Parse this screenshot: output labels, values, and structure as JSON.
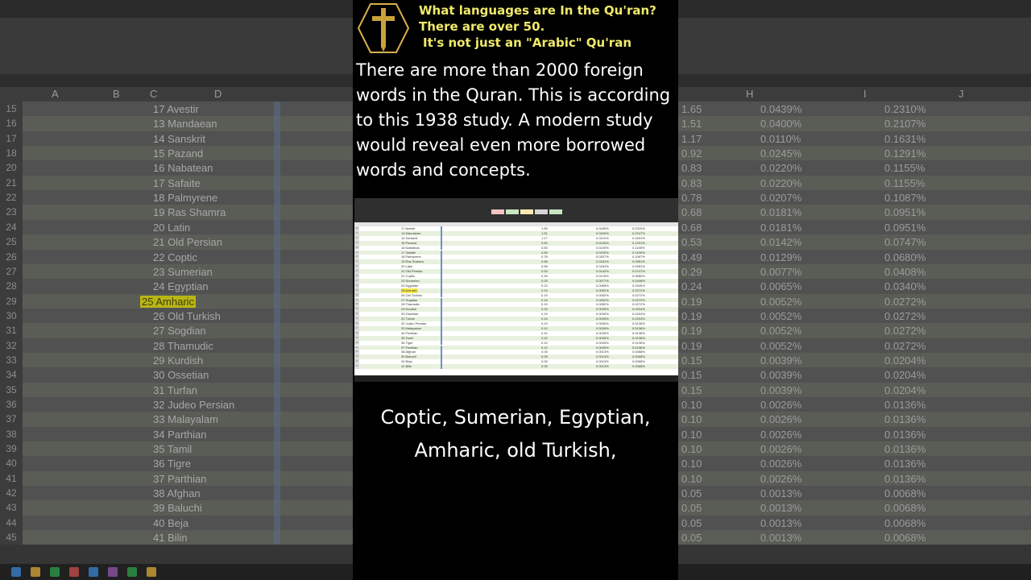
{
  "header": {
    "line1": "What languages are In the Qu'ran?",
    "line2": "There are over 50.",
    "line3": "It's not just an \"Arabic\" Qu'ran"
  },
  "body_text": "There are more than 2000 foreign words in the Quran. This is according to this 1938 study. A modern study would reveal even more borrowed words and concepts.",
  "caption": {
    "line1": "Coptic, Sumerian, Egyptian,",
    "line2": "Amharic, old Turkish,"
  },
  "icons": {
    "logo": "golden-cross-icon"
  },
  "colors": {
    "header_text": "#f1ea6a",
    "highlight": "#b9b514",
    "panel_bg": "#000000"
  },
  "background_sheet": {
    "columns": [
      "A",
      "B",
      "C",
      "D",
      "H",
      "I",
      "J"
    ],
    "rows": [
      {
        "n": "15",
        "lang": "17 Avestir",
        "v1": "1.65",
        "v2": "0.0439%",
        "v3": "0.2310%"
      },
      {
        "n": "16",
        "lang": "13 Mandaean",
        "v1": "1.51",
        "v2": "0.0400%",
        "v3": "0.2107%"
      },
      {
        "n": "17",
        "lang": "14 Sanskrit",
        "v1": "1.17",
        "v2": "0.0110%",
        "v3": "0.1631%"
      },
      {
        "n": "18",
        "lang": "15 Pazand",
        "v1": "0.92",
        "v2": "0.0245%",
        "v3": "0.1291%"
      },
      {
        "n": "20",
        "lang": "16 Nabatean",
        "v1": "0.83",
        "v2": "0.0220%",
        "v3": "0.1155%"
      },
      {
        "n": "21",
        "lang": "17 Safaite",
        "v1": "0.83",
        "v2": "0.0220%",
        "v3": "0.1155%"
      },
      {
        "n": "22",
        "lang": "18 Palmyrene",
        "v1": "0.78",
        "v2": "0.0207%",
        "v3": "0.1087%"
      },
      {
        "n": "23",
        "lang": "19 Ras Shamra",
        "v1": "0.68",
        "v2": "0.0181%",
        "v3": "0.0951%"
      },
      {
        "n": "24",
        "lang": "20 Latin",
        "v1": "0.68",
        "v2": "0.0181%",
        "v3": "0.0951%"
      },
      {
        "n": "25",
        "lang": "21 Old Persian",
        "v1": "0.53",
        "v2": "0.0142%",
        "v3": "0.0747%"
      },
      {
        "n": "26",
        "lang": "22 Coptic",
        "v1": "0.49",
        "v2": "0.0129%",
        "v3": "0.0680%"
      },
      {
        "n": "27",
        "lang": "23 Sumerian",
        "v1": "0.29",
        "v2": "0.0077%",
        "v3": "0.0408%"
      },
      {
        "n": "28",
        "lang": "24 Egyptian",
        "v1": "0.24",
        "v2": "0.0065%",
        "v3": "0.0340%"
      },
      {
        "n": "29",
        "lang": "25 Amharic",
        "v1": "0.19",
        "v2": "0.0052%",
        "v3": "0.0272%"
      },
      {
        "n": "30",
        "lang": "26 Old Turkish",
        "v1": "0.19",
        "v2": "0.0052%",
        "v3": "0.0272%"
      },
      {
        "n": "31",
        "lang": "27 Sogdian",
        "v1": "0.19",
        "v2": "0.0052%",
        "v3": "0.0272%"
      },
      {
        "n": "32",
        "lang": "28 Thamudic",
        "v1": "0.19",
        "v2": "0.0052%",
        "v3": "0.0272%"
      },
      {
        "n": "33",
        "lang": "29 Kurdish",
        "v1": "0.15",
        "v2": "0.0039%",
        "v3": "0.0204%"
      },
      {
        "n": "34",
        "lang": "30 Ossetian",
        "v1": "0.15",
        "v2": "0.0039%",
        "v3": "0.0204%"
      },
      {
        "n": "35",
        "lang": "31 Turfan",
        "v1": "0.15",
        "v2": "0.0039%",
        "v3": "0.0204%"
      },
      {
        "n": "36",
        "lang": "32 Judeo Persian",
        "v1": "0.10",
        "v2": "0.0026%",
        "v3": "0.0136%"
      },
      {
        "n": "37",
        "lang": "33 Malayalam",
        "v1": "0.10",
        "v2": "0.0026%",
        "v3": "0.0136%"
      },
      {
        "n": "38",
        "lang": "34 Parthian",
        "v1": "0.10",
        "v2": "0.0026%",
        "v3": "0.0136%"
      },
      {
        "n": "39",
        "lang": "35 Tamil",
        "v1": "0.10",
        "v2": "0.0026%",
        "v3": "0.0136%"
      },
      {
        "n": "40",
        "lang": "36 Tigre",
        "v1": "0.10",
        "v2": "0.0026%",
        "v3": "0.0136%"
      },
      {
        "n": "41",
        "lang": "37 Parthian",
        "v1": "0.10",
        "v2": "0.0026%",
        "v3": "0.0136%"
      },
      {
        "n": "42",
        "lang": "38 Afghan",
        "v1": "0.05",
        "v2": "0.0013%",
        "v3": "0.0068%"
      },
      {
        "n": "43",
        "lang": "39 Baluchi",
        "v1": "0.05",
        "v2": "0.0013%",
        "v3": "0.0068%"
      },
      {
        "n": "44",
        "lang": "40 Beja",
        "v1": "0.05",
        "v2": "0.0013%",
        "v3": "0.0068%"
      },
      {
        "n": "45",
        "lang": "41 Bilin",
        "v1": "0.05",
        "v2": "0.0013%",
        "v3": "0.0068%"
      }
    ],
    "highlighted_row_index": 13
  }
}
